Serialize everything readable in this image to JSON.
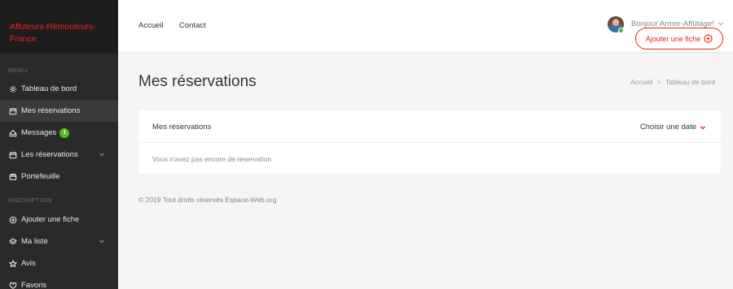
{
  "brand": {
    "name": "Affuteurs-Rémouleurs-France"
  },
  "sidebar": {
    "section_menu": "MENU",
    "section_inscription": "INSCRIPTION",
    "menu_items": [
      {
        "label": "Tableau de bord",
        "icon": "gear-icon"
      },
      {
        "label": "Mes réservations",
        "icon": "calendar-icon",
        "active": true
      },
      {
        "label": "Messages",
        "icon": "message-icon",
        "badge": "1"
      },
      {
        "label": "Les réservations",
        "icon": "calendar-icon"
      },
      {
        "label": "Portefeuille",
        "icon": "wallet-icon"
      }
    ],
    "inscription_items": [
      {
        "label": "Ajouter une fiche",
        "icon": "plus-circle-icon"
      },
      {
        "label": "Ma liste",
        "icon": "layers-icon"
      },
      {
        "label": "Avis",
        "icon": "star-icon"
      },
      {
        "label": "Favoris",
        "icon": "heart-icon"
      }
    ]
  },
  "header": {
    "nav": {
      "home": "Accueil",
      "contact": "Contact"
    },
    "greeting": "Bonjour Armor-Affûtage!",
    "add_button": "Ajouter une fiche"
  },
  "main": {
    "title": "Mes réservations",
    "breadcrumb": {
      "home": "Accueil",
      "separator": ">",
      "current": "Tableau de bord"
    },
    "card": {
      "title": "Mes réservations",
      "date_select": "Choisir une date",
      "empty_message": "Vous n'avez pas encore de réservation"
    },
    "footer": "© 2019 Tout droits réservés Espace-Web.org"
  },
  "colors": {
    "accent": "#e5251d",
    "sidebar_bg": "#2a2a2a",
    "badge": "#54ba1d"
  }
}
